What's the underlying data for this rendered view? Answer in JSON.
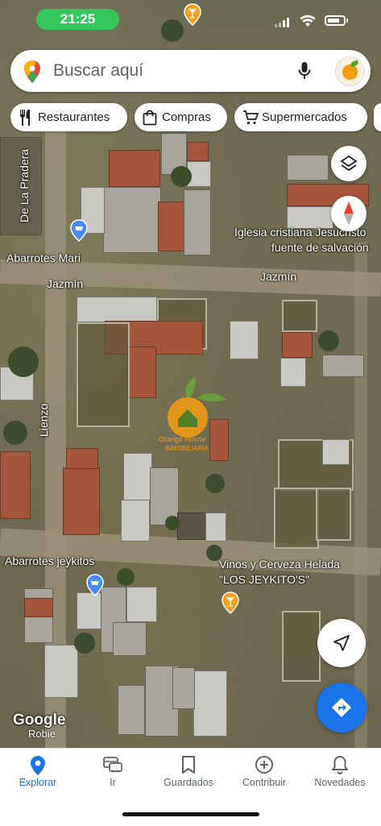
{
  "status_bar": {
    "time": "21:25"
  },
  "search": {
    "placeholder": "Buscar aquí"
  },
  "chips": [
    {
      "label": "Restaurantes",
      "icon": "fork-knife-icon"
    },
    {
      "label": "Compras",
      "icon": "shopping-bag-icon"
    },
    {
      "label": "Supermercados",
      "icon": "cart-icon"
    }
  ],
  "map": {
    "labels": {
      "de_la_pradera": "De La Pradera",
      "abarrotes_mari": "Abarrotes Mari",
      "jazmin_1": "Jazmín",
      "jazmin_2": "Jazmín",
      "iglesia_1": "Iglesia cristiana Jesucristo",
      "iglesia_2": "fuente de salvación",
      "lienzo": "Lienzo",
      "abarrotes_jeykitos": "Abarrotes jeykitos",
      "vinos_1": "Vinos y Cerveza Helada",
      "vinos_2": "\"LOS JEYKITO'S\"",
      "watermark_1": "Orange House",
      "watermark_2": "INMOBILIARIA"
    },
    "attribution": {
      "logo": "Google",
      "credit": "Robie"
    }
  },
  "bottom_nav": [
    {
      "label": "Explorar",
      "icon": "location-pin-icon",
      "active": true
    },
    {
      "label": "Ir",
      "icon": "car-icon",
      "active": false
    },
    {
      "label": "Guardados",
      "icon": "bookmark-icon",
      "active": false
    },
    {
      "label": "Contribuir",
      "icon": "plus-circle-icon",
      "active": false
    },
    {
      "label": "Novedades",
      "icon": "bell-icon",
      "active": false
    }
  ],
  "colors": {
    "accent": "#1a73e8",
    "time_pill": "#34c759",
    "compass_red": "#ea4335",
    "poi_blue": "#4a8af4",
    "poi_orange": "#f2a024"
  }
}
